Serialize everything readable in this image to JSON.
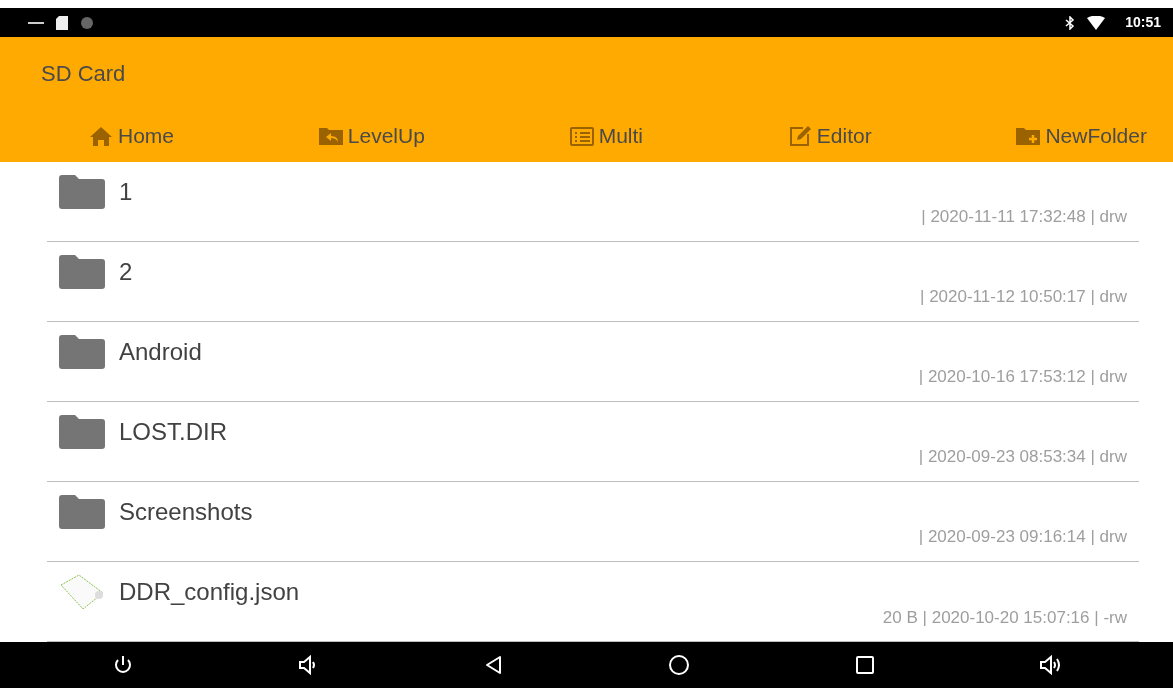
{
  "status_bar": {
    "time": "10:51"
  },
  "header": {
    "title": "SD Card"
  },
  "toolbar": [
    {
      "kind": "home",
      "label": "Home"
    },
    {
      "kind": "levelup",
      "label": "LevelUp"
    },
    {
      "kind": "multi",
      "label": "Multi"
    },
    {
      "kind": "editor",
      "label": "Editor"
    },
    {
      "kind": "newfolder",
      "label": "NewFolder"
    }
  ],
  "files": [
    {
      "kind": "folder",
      "name": "1",
      "meta": "| 2020-11-11 17:32:48 | drw"
    },
    {
      "kind": "folder",
      "name": "2",
      "meta": "| 2020-11-12 10:50:17 | drw"
    },
    {
      "kind": "folder",
      "name": "Android",
      "meta": "| 2020-10-16 17:53:12 | drw"
    },
    {
      "kind": "folder",
      "name": "LOST.DIR",
      "meta": "| 2020-09-23 08:53:34 | drw"
    },
    {
      "kind": "folder",
      "name": "Screenshots",
      "meta": "| 2020-09-23 09:16:14 | drw"
    },
    {
      "kind": "file",
      "name": "DDR_config.json",
      "meta": "20 B | 2020-10-20 15:07:16 | -rw"
    }
  ]
}
